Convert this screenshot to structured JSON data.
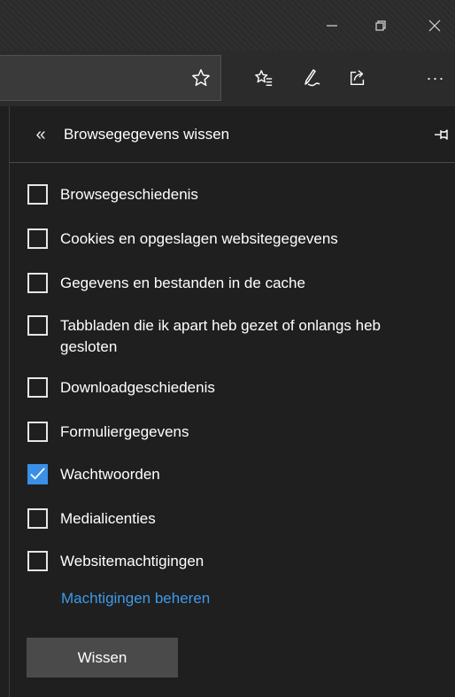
{
  "titlebar": {
    "minimize_glyph": "–",
    "restore_icon": "restore-icon",
    "close_glyph": "✕"
  },
  "toolbar": {
    "icons": [
      "star-icon",
      "favorites-icon",
      "pen-icon",
      "share-icon",
      "more-icon"
    ],
    "more_glyph": "···"
  },
  "panel": {
    "back_glyph": "«",
    "title": "Browsegegevens wissen",
    "options": [
      {
        "label": "Browsegeschiedenis",
        "checked": false
      },
      {
        "label": "Cookies en opgeslagen websitegegevens",
        "checked": false
      },
      {
        "label": "Gegevens en bestanden in de cache",
        "checked": false
      },
      {
        "label": "Tabbladen die ik apart heb gezet of onlangs heb gesloten",
        "checked": false
      },
      {
        "label": "Downloadgeschiedenis",
        "checked": false
      },
      {
        "label": "Formuliergegevens",
        "checked": false
      },
      {
        "label": "Wachtwoorden",
        "checked": true
      },
      {
        "label": "Medialicenties",
        "checked": false
      },
      {
        "label": "Websitemachtigingen",
        "checked": false
      }
    ],
    "manage_link": "Machtigingen beheren",
    "wipe_button": "Wissen"
  },
  "colors": {
    "accent": "#3a90e6",
    "link": "#3d9ae8",
    "panel_bg": "#1f1f1f",
    "button_bg": "#4a4a4a"
  }
}
